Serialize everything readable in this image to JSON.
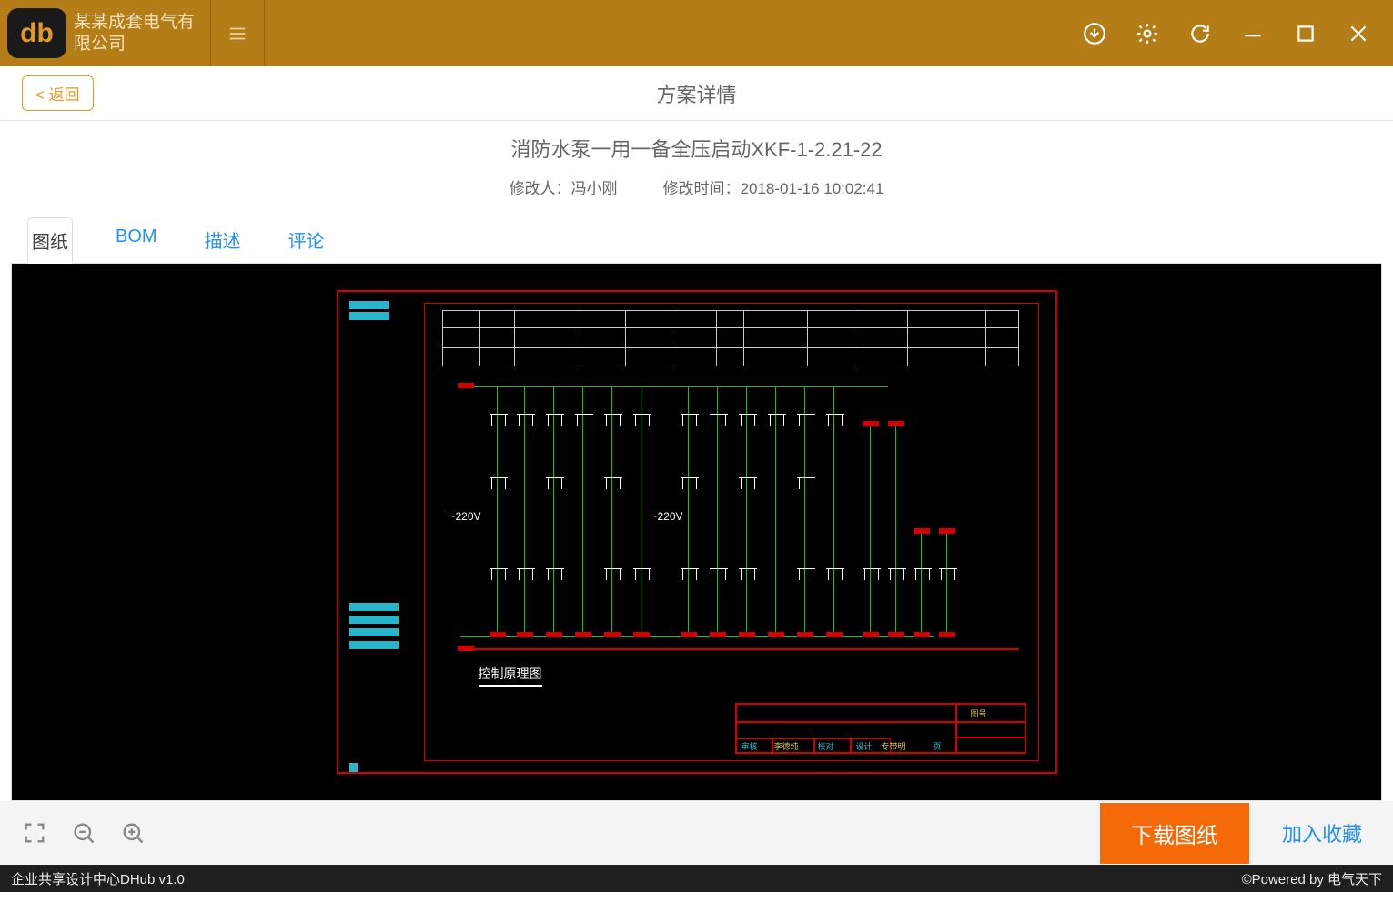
{
  "header": {
    "company_name": "某某成套电气有限公司",
    "logo_text": "db"
  },
  "toolbar": {
    "back_label": "< 返回",
    "page_title": "方案详情"
  },
  "plan": {
    "title": "消防水泵一用一备全压启动XKF-1-2.21-22",
    "modifier_label": "修改人：",
    "modifier": "冯小刚",
    "modtime_label": "修改时间：",
    "modtime": "2018-01-16 10:02:41"
  },
  "tabs": [
    "图纸",
    "BOM",
    "描述",
    "评论"
  ],
  "drawing": {
    "voltage_left": "~220V",
    "voltage_right": "~220V",
    "schematic_label": "控制原理图"
  },
  "actions": {
    "download_label": "下载图纸",
    "favorite_label": "加入收藏"
  },
  "footer": {
    "left": "企业共享设计中心DHub v1.0",
    "right": "©Powered by 电气天下"
  }
}
